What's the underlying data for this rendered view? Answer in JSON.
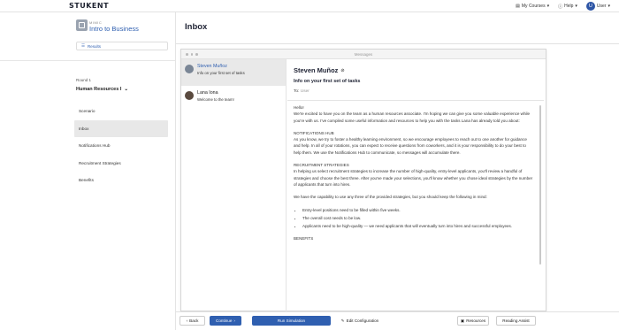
{
  "topbar": {
    "brand": "STUKENT",
    "my_courses": "My Courses",
    "help": "Help",
    "avatar_initial": "U",
    "user": "User"
  },
  "sidebar": {
    "course_kicker": "MIMIC",
    "course_title": "Intro to Business",
    "results_label": "Results",
    "round_label": "Round 1",
    "module": "Human Resources I",
    "nav": [
      "Scenario",
      "Inbox",
      "Notifications Hub",
      "Recruitment Strategies",
      "Benefits"
    ],
    "active_nav": "Inbox"
  },
  "main": {
    "title": "Inbox",
    "window_title": "Messages"
  },
  "inbox": [
    {
      "name": "Steven Muñoz",
      "subject": "Info on your first set of tasks",
      "selected": true
    },
    {
      "name": "Lana Iona",
      "subject": "Welcome to the team!",
      "selected": false
    }
  ],
  "message": {
    "sender": "Steven Muñoz",
    "subject": "Info on your first set of tasks",
    "to_label": "To:",
    "to_value": "User",
    "greeting": "Hello!",
    "p1": "We're excited to have you on the team as a human resources associate. I'm hoping we can give you some valuable experience while you're with us. I've compiled some useful information and resources to help you with the tasks Lana has already told you about:",
    "h1": "NOTIFICATIONS HUB",
    "p2": "As you know, we try to foster a healthy learning environment, so we encourage employees to reach out to one another for guidance and help. In all of your rotations, you can expect to receive questions from coworkers, and it is your responsibility to do your best to help them. We use the Notifications Hub to communicate, so messages will accumulate there.",
    "h2": "RECRUITMENT STRATEGIES",
    "p3": "In helping us select recruitment strategies to increase the number of high-quality, entry-level applicants, you'll review a handful of strategies and choose the best three. After you've made your selections, you'll know whether you chose ideal strategies by the number of applicants that turn into hires.",
    "p4": "We have the capability to use any three of the provided strategies, but you should keep the following in mind:",
    "bullets": [
      "Entry-level positions need to be filled within five weeks.",
      "The overall cost needs to be low.",
      "Applicants need to be high-quality — we need applicants that will eventually turn into hires and successful employees."
    ],
    "h3": "BENEFITS"
  },
  "toolbar": {
    "back": "Back",
    "continue": "Continue",
    "run": "Run Simulation",
    "edit": "Edit Configuration",
    "resources": "Resources",
    "reading_assist": "Reading Assist"
  },
  "colors": {
    "accent": "#2f5fb0",
    "avatar": "#2e56a6"
  }
}
